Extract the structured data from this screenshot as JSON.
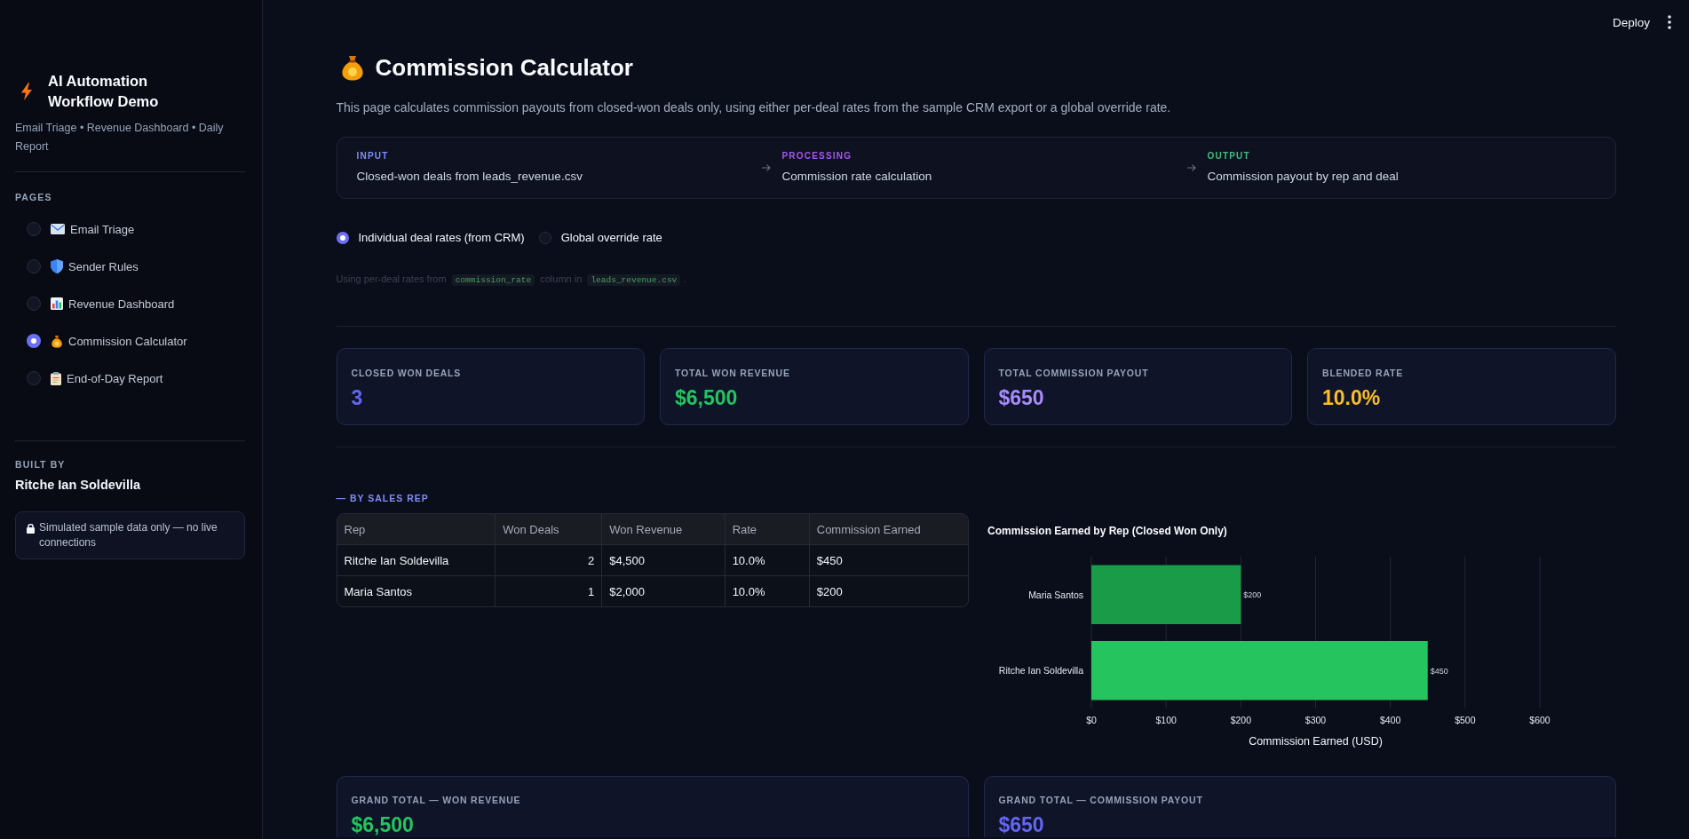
{
  "header": {
    "deploy_label": "Deploy"
  },
  "sidebar": {
    "title": "AI Automation Workflow Demo",
    "subtitle": "Email Triage • Revenue Dashboard • Daily Report",
    "pages_heading": "PAGES",
    "pages": [
      {
        "label": "Email Triage",
        "selected": false
      },
      {
        "label": "Sender Rules",
        "selected": false
      },
      {
        "label": "Revenue Dashboard",
        "selected": false
      },
      {
        "label": "Commission Calculator",
        "selected": true
      },
      {
        "label": "End-of-Day Report",
        "selected": false
      }
    ],
    "built_by_heading": "BUILT BY",
    "author": "Ritche Ian Soldevilla",
    "note": "Simulated sample data only — no live connections"
  },
  "page": {
    "title": "Commission Calculator",
    "description": "This page calculates commission payouts from closed-won deals only, using either per-deal rates from the sample CRM export or a global override rate."
  },
  "pipeline": [
    {
      "label": "INPUT",
      "text": "Closed-won deals from leads_revenue.csv",
      "color": "#818cf8"
    },
    {
      "label": "PROCESSING",
      "text": "Commission rate calculation",
      "color": "#a855f7"
    },
    {
      "label": "OUTPUT",
      "text": "Commission payout by rep and deal",
      "color": "#3fbf7f"
    }
  ],
  "rate_mode": [
    {
      "label": "Individual deal rates (from CRM)",
      "selected": true
    },
    {
      "label": "Global override rate",
      "selected": false
    }
  ],
  "caption": [
    {
      "kind": "text",
      "text": "Using per-deal rates from "
    },
    {
      "kind": "code",
      "text": "commission_rate"
    },
    {
      "kind": "text",
      "text": " column in "
    },
    {
      "kind": "code",
      "text": "leads_revenue.csv"
    },
    {
      "kind": "text",
      "text": "."
    }
  ],
  "metrics": [
    {
      "label": "CLOSED WON DEALS",
      "value": "3",
      "color": "#6366f1"
    },
    {
      "label": "TOTAL WON REVENUE",
      "value": "$6,500",
      "color": "#22c55e"
    },
    {
      "label": "TOTAL COMMISSION PAYOUT",
      "value": "$650",
      "color": "#a78bfa"
    },
    {
      "label": "BLENDED RATE",
      "value": "10.0%",
      "color": "#fbbf24"
    }
  ],
  "by_rep": {
    "heading": "— BY SALES REP",
    "table": {
      "columns": [
        "Rep",
        "Won Deals",
        "Won Revenue",
        "Rate",
        "Commission Earned"
      ],
      "rows": [
        [
          "Ritche Ian Soldevilla",
          "2",
          "$4,500",
          "10.0%",
          "$450"
        ],
        [
          "Maria Santos",
          "1",
          "$2,000",
          "10.0%",
          "$200"
        ]
      ]
    },
    "chart_data": {
      "type": "bar",
      "orientation": "horizontal",
      "title": "Commission Earned by Rep (Closed Won Only)",
      "xlabel": "Commission Earned (USD)",
      "categories": [
        "Maria Santos",
        "Ritche Ian Soldevilla"
      ],
      "values": [
        200,
        450
      ],
      "xlim": [
        0,
        600
      ],
      "xticks": [
        {
          "value": 0,
          "label": "$0"
        },
        {
          "value": 100,
          "label": "$100"
        },
        {
          "value": 200,
          "label": "$200"
        },
        {
          "value": 300,
          "label": "$300"
        },
        {
          "value": 400,
          "label": "$400"
        },
        {
          "value": 500,
          "label": "$500"
        },
        {
          "value": 600,
          "label": "$600"
        }
      ],
      "grid": true,
      "value_labels": [
        "$200",
        "$450"
      ]
    }
  },
  "grand_totals": [
    {
      "label": "GRAND TOTAL — WON REVENUE",
      "value": "$6,500",
      "color": "#22c55e"
    },
    {
      "label": "GRAND TOTAL — COMMISSION PAYOUT",
      "value": "$650",
      "color": "#6366f1"
    }
  ]
}
